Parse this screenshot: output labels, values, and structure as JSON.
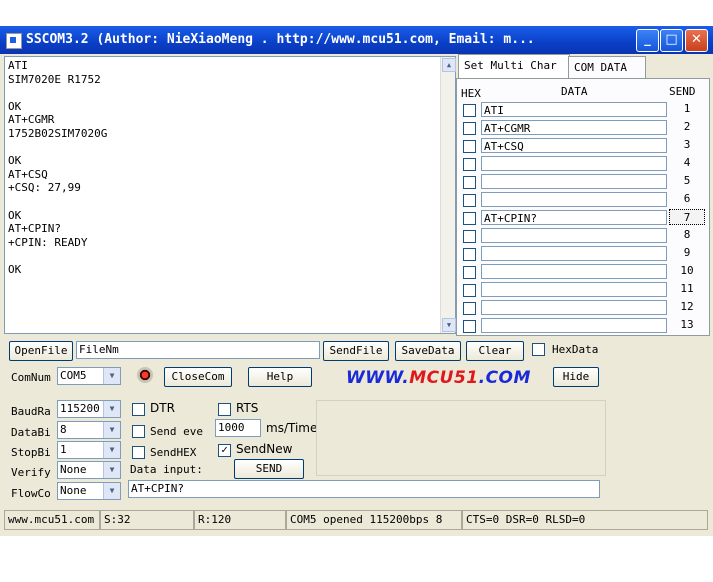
{
  "window": {
    "title": "SSCOM3.2 (Author: NieXiaoMeng .  http://www.mcu51.com,  Email: m...",
    "minimize": "_",
    "maximize": "□",
    "close": "✕"
  },
  "receive": {
    "text": "ATI\nSIM7020E R1752\n\nOK\nAT+CGMR\n1752B02SIM7020G\n\nOK\nAT+CSQ\n+CSQ: 27,99\n\nOK\nAT+CPIN?\n+CPIN: READY\n\nOK"
  },
  "tabs": [
    {
      "label": "Set Multi Char"
    },
    {
      "label": "COM DATA"
    }
  ],
  "multi": {
    "header_hex": "HEX",
    "header_data": "DATA",
    "header_send": "SEND",
    "rows": [
      {
        "data": "ATI",
        "send": "1"
      },
      {
        "data": "AT+CGMR",
        "send": "2"
      },
      {
        "data": "AT+CSQ",
        "send": "3"
      },
      {
        "data": "",
        "send": "4"
      },
      {
        "data": "",
        "send": "5"
      },
      {
        "data": "",
        "send": "6"
      },
      {
        "data": "AT+CPIN?",
        "send": "7"
      },
      {
        "data": "",
        "send": "8"
      },
      {
        "data": "",
        "send": "9"
      },
      {
        "data": "",
        "send": "10"
      },
      {
        "data": "",
        "send": "11"
      },
      {
        "data": "",
        "send": "12"
      },
      {
        "data": "",
        "send": "13"
      }
    ]
  },
  "toolbar": {
    "openfile": "OpenFile",
    "filename": "FileNm",
    "sendfile": "SendFile",
    "savedata": "SaveData",
    "clear": "Clear",
    "hexdata": "HexData",
    "comnum_label": "ComNum",
    "comnum_value": "COM5",
    "closecom": "CloseCom",
    "help": "Help",
    "brand_a": "WWW.",
    "brand_b": "MCU51",
    "brand_c": ".COM",
    "hide": "Hide"
  },
  "settings": {
    "baud_label": "BaudRa",
    "baud_value": "115200",
    "databits_label": "DataBi",
    "databits_value": "8",
    "stopbits_label": "StopBi",
    "stopbits_value": "1",
    "verify_label": "Verify",
    "verify_value": "None",
    "flow_label": "FlowCo",
    "flow_value": "None",
    "dtr": "DTR",
    "rts": "RTS",
    "send_every": "Send eve",
    "interval": "1000",
    "ms_time": "ms/Time",
    "sendhex": "SendHEX",
    "sendnew": "SendNew",
    "data_input_label": "Data input:",
    "send": "SEND",
    "input_value": "AT+CPIN?"
  },
  "status": {
    "site": "www.mcu51.com",
    "sent": "S:32",
    "received": "R:120",
    "port": "COM5 opened 115200bps  8",
    "lines": "CTS=0 DSR=0 RLSD=0"
  }
}
